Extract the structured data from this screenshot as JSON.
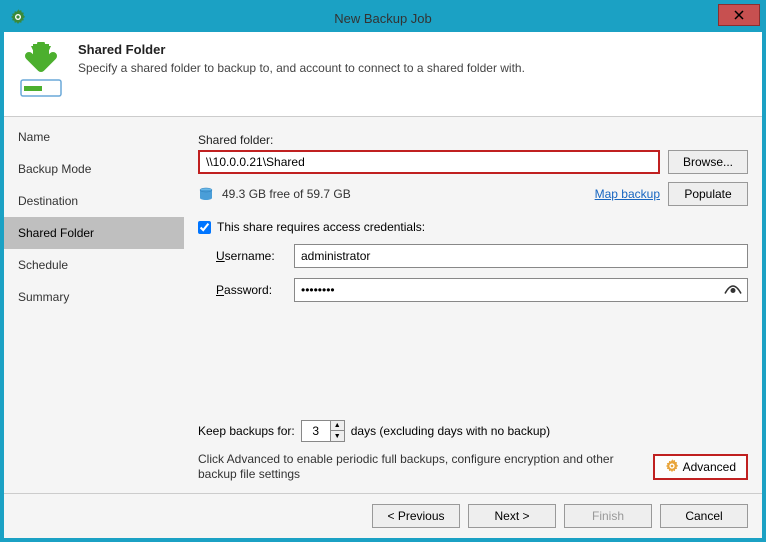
{
  "window": {
    "title": "New Backup Job"
  },
  "header": {
    "title": "Shared Folder",
    "subtitle": "Specify a shared folder to backup to, and account to connect to a shared folder with."
  },
  "sidebar": {
    "items": [
      {
        "label": "Name"
      },
      {
        "label": "Backup Mode"
      },
      {
        "label": "Destination"
      },
      {
        "label": "Shared Folder"
      },
      {
        "label": "Schedule"
      },
      {
        "label": "Summary"
      }
    ],
    "activeIndex": 3
  },
  "main": {
    "shared_folder_label": "Shared folder:",
    "shared_folder_value": "\\\\10.0.0.21\\Shared",
    "browse_label": "Browse...",
    "disk_free_text": "49.3 GB free of 59.7 GB",
    "map_backup_label": "Map backup",
    "populate_label": "Populate",
    "requires_creds_label": "This share requires access credentials:",
    "requires_creds_checked": true,
    "username_label": "Username:",
    "username_value": "administrator",
    "password_label": "Password:",
    "password_value": "••••••••",
    "keep_label_pre": "Keep backups for:",
    "keep_value": "3",
    "keep_label_post": "days (excluding days with no backup)",
    "advanced_text": "Click Advanced to enable periodic full backups, configure encryption and other backup file settings",
    "advanced_label": "Advanced"
  },
  "footer": {
    "previous": "< Previous",
    "next": "Next >",
    "finish": "Finish",
    "cancel": "Cancel"
  }
}
